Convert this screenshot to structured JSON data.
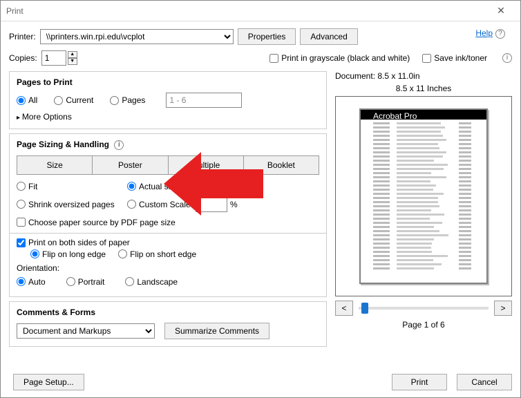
{
  "title": "Print",
  "help": "Help",
  "printer_label": "Printer:",
  "printer_value": "\\\\printers.win.rpi.edu\\vcplot",
  "properties_btn": "Properties",
  "advanced_btn": "Advanced",
  "copies_label": "Copies:",
  "copies_value": "1",
  "grayscale": "Print in grayscale (black and white)",
  "save_ink": "Save ink/toner",
  "pages": {
    "title": "Pages to Print",
    "all": "All",
    "current": "Current",
    "pages": "Pages",
    "range": "1 - 6",
    "more": "More Options"
  },
  "sizing": {
    "title": "Page Sizing & Handling",
    "size": "Size",
    "poster": "Poster",
    "multiple": "Multiple",
    "booklet": "Booklet",
    "fit": "Fit",
    "actual": "Actual size",
    "shrink": "Shrink oversized pages",
    "custom": "Custom Scale:",
    "scale_suffix": "%",
    "choose_paper": "Choose paper source by PDF page size",
    "both_sides": "Print on both sides of paper",
    "flip_long": "Flip on long edge",
    "flip_short": "Flip on short edge",
    "orientation": "Orientation:",
    "auto": "Auto",
    "portrait": "Portrait",
    "landscape": "Landscape"
  },
  "comments": {
    "title": "Comments & Forms",
    "value": "Document and Markups",
    "summarize": "Summarize Comments"
  },
  "preview": {
    "doc": "Document: 8.5 x 11.0in",
    "sub": "8.5 x 11 Inches",
    "page_of": "Page 1 of 6",
    "prev": "<",
    "next": ">"
  },
  "page_setup": "Page Setup...",
  "print": "Print",
  "cancel": "Cancel"
}
